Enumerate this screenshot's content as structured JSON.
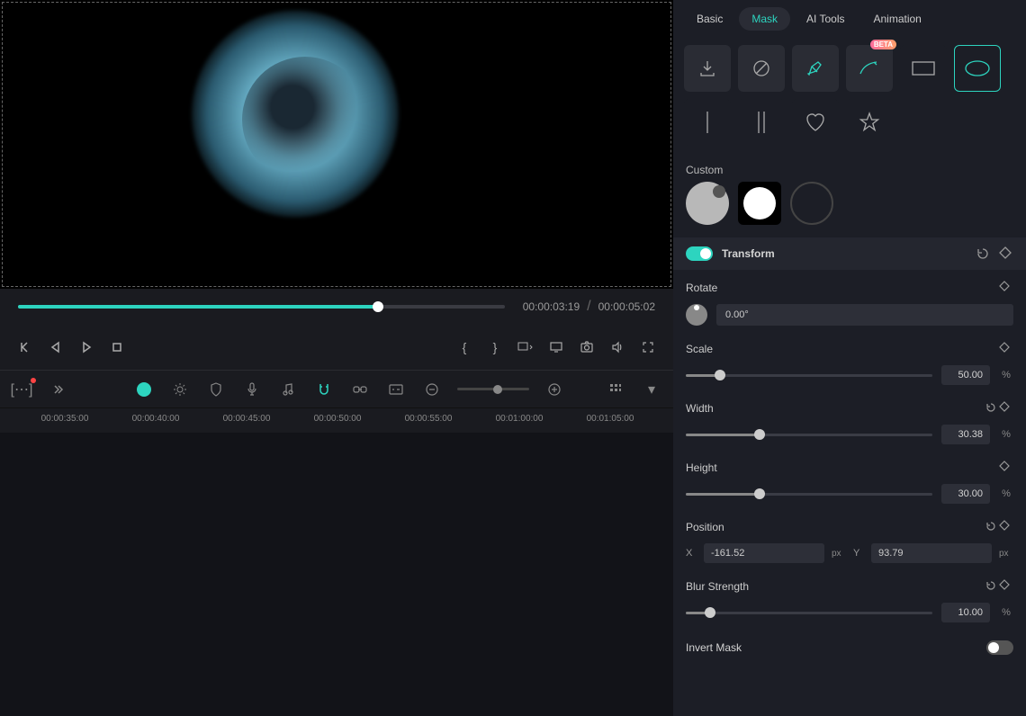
{
  "tabs": {
    "basic": "Basic",
    "mask": "Mask",
    "ai": "AI Tools",
    "animation": "Animation"
  },
  "shapes": {
    "beta": "BETA"
  },
  "custom": {
    "label": "Custom"
  },
  "transform": {
    "header": "Transform",
    "rotate": {
      "label": "Rotate",
      "value": "0.00°"
    },
    "scale": {
      "label": "Scale",
      "value": "50.00",
      "unit": "%",
      "pct": 14
    },
    "width": {
      "label": "Width",
      "value": "30.38",
      "unit": "%",
      "pct": 30
    },
    "height": {
      "label": "Height",
      "value": "30.00",
      "unit": "%",
      "pct": 30
    },
    "position": {
      "label": "Position",
      "x": "-161.52",
      "y": "93.79",
      "unit": "px"
    },
    "blur": {
      "label": "Blur Strength",
      "value": "10.00",
      "unit": "%",
      "pct": 10
    },
    "invert": {
      "label": "Invert Mask"
    }
  },
  "playback": {
    "current": "00:00:03:19",
    "sep": "/",
    "total": "00:00:05:02",
    "progress_pct": 74
  },
  "timeline": {
    "marks": [
      "00:00:35:00",
      "00:00:40:00",
      "00:00:45:00",
      "00:00:50:00",
      "00:00:55:00",
      "00:01:00:00",
      "00:01:05:00"
    ]
  }
}
